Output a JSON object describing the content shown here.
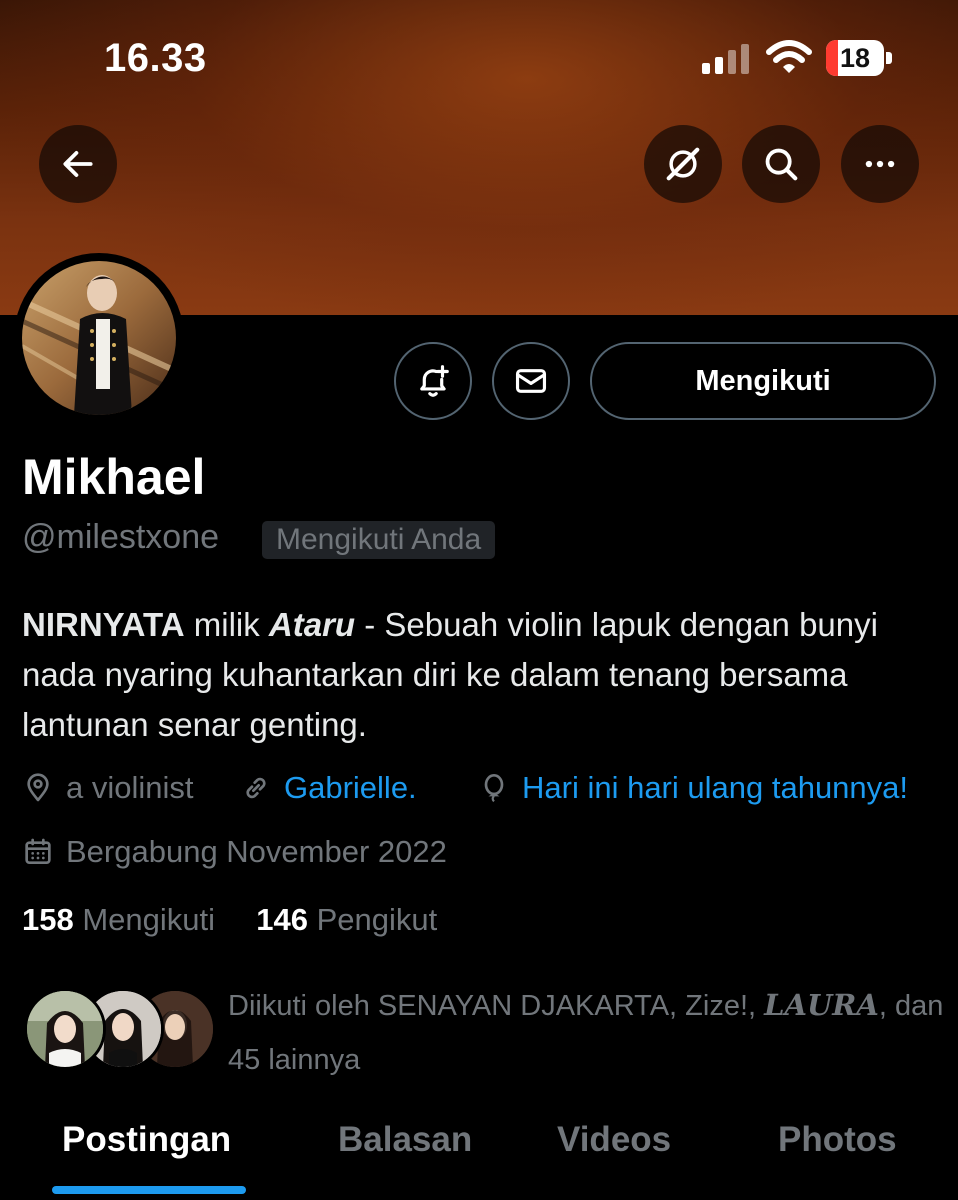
{
  "status_bar": {
    "time": "16.33",
    "battery": "18"
  },
  "profile": {
    "name": "Mikhael",
    "handle": "@milestxone",
    "follows_you_badge": "Mengikuti Anda",
    "follow_button": "Mengikuti",
    "bio": {
      "part1_bold": "NIRNYATA",
      "part2": " milik ",
      "part3_bold_italic": "Ataru",
      "part4": " - Sebuah violin lapuk dengan bunyi nada nyaring kuhantarkan diri ke dalam tenang bersama lantunan senar genting."
    },
    "location": "a violinist",
    "website": "Gabrielle.",
    "birthday": "Hari ini hari ulang tahunnya!",
    "joined": "Bergabung November 2022",
    "following_count": "158",
    "following_label": " Mengikuti",
    "followers_count": "146",
    "followers_label": " Pengikut",
    "followed_by": {
      "prefix": "Diikuti oleh SENAYAN DJAKARTA, Zize!, ",
      "name3": "LAURA",
      "suffix": ", dan 45 lainnya"
    }
  },
  "tabs": [
    {
      "label": "Postingan",
      "active": true
    },
    {
      "label": "Balasan",
      "active": false
    },
    {
      "label": "Videos",
      "active": false
    },
    {
      "label": "Photos",
      "active": false
    }
  ],
  "colors": {
    "accent": "#1d9bf0",
    "secondary_text": "#71767b",
    "background": "#000000",
    "battery_low": "#ff3b30"
  },
  "icons": [
    "back-arrow-icon",
    "grok-icon",
    "search-icon",
    "more-icon",
    "notification-bell-plus-icon",
    "mail-icon",
    "location-pin-icon",
    "link-icon",
    "balloon-icon",
    "calendar-icon",
    "cellular-signal-icon",
    "wifi-icon",
    "battery-icon"
  ]
}
